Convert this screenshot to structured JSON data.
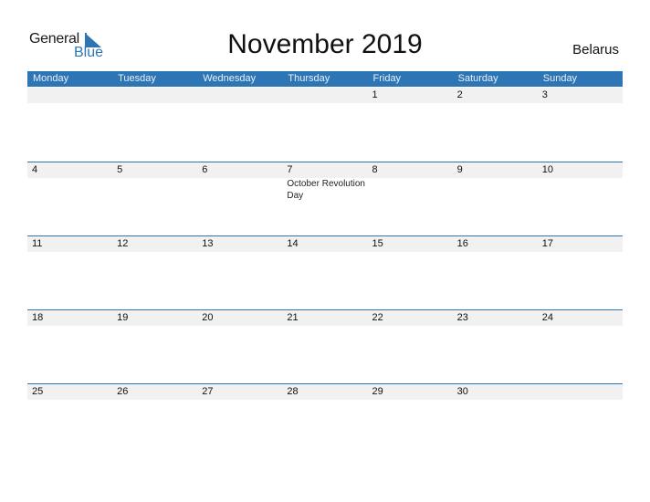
{
  "logo": {
    "word1": "General",
    "word2": "Blue"
  },
  "title": "November 2019",
  "country": "Belarus",
  "colors": {
    "accent": "#2e75b6",
    "band": "#f1f1f1"
  },
  "weekdays": [
    "Monday",
    "Tuesday",
    "Wednesday",
    "Thursday",
    "Friday",
    "Saturday",
    "Sunday"
  ],
  "weeks": [
    [
      {
        "d": ""
      },
      {
        "d": ""
      },
      {
        "d": ""
      },
      {
        "d": ""
      },
      {
        "d": "1"
      },
      {
        "d": "2"
      },
      {
        "d": "3"
      }
    ],
    [
      {
        "d": "4"
      },
      {
        "d": "5"
      },
      {
        "d": "6"
      },
      {
        "d": "7",
        "event": "October Revolution Day"
      },
      {
        "d": "8"
      },
      {
        "d": "9"
      },
      {
        "d": "10"
      }
    ],
    [
      {
        "d": "11"
      },
      {
        "d": "12"
      },
      {
        "d": "13"
      },
      {
        "d": "14"
      },
      {
        "d": "15"
      },
      {
        "d": "16"
      },
      {
        "d": "17"
      }
    ],
    [
      {
        "d": "18"
      },
      {
        "d": "19"
      },
      {
        "d": "20"
      },
      {
        "d": "21"
      },
      {
        "d": "22"
      },
      {
        "d": "23"
      },
      {
        "d": "24"
      }
    ],
    [
      {
        "d": "25"
      },
      {
        "d": "26"
      },
      {
        "d": "27"
      },
      {
        "d": "28"
      },
      {
        "d": "29"
      },
      {
        "d": "30"
      },
      {
        "d": ""
      }
    ]
  ]
}
